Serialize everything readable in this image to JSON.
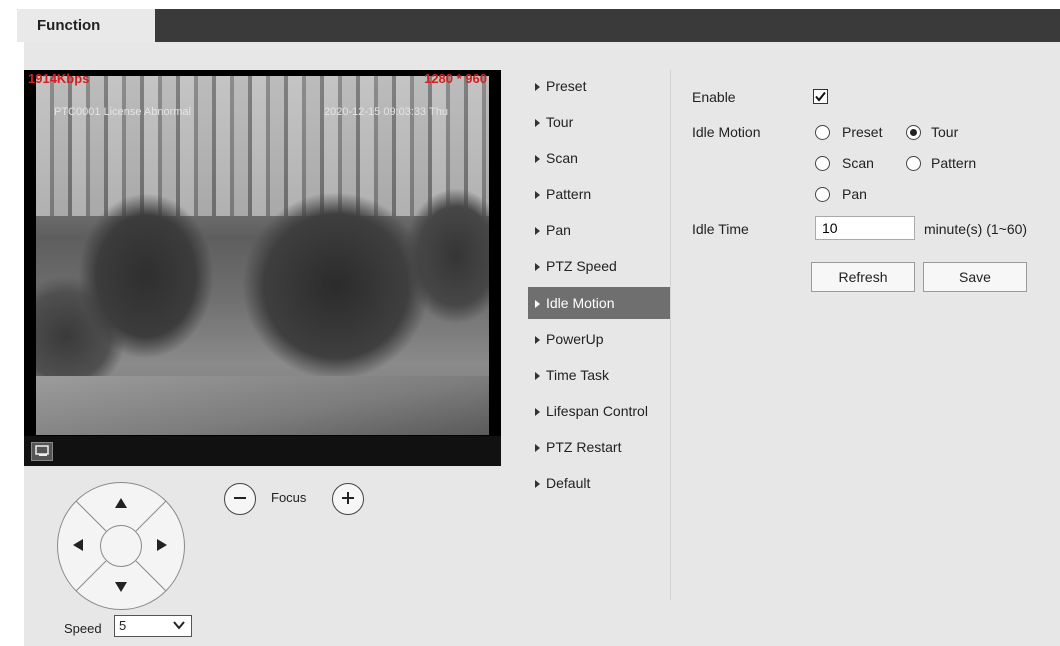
{
  "tabs": {
    "function": "Function"
  },
  "video": {
    "bitrate": "1914Kbps",
    "resolution": "1280 * 960",
    "osd_left": "PTC0001 License Abnormal",
    "osd_right": "2020-12-15 09:03:33 Thu"
  },
  "ptz": {
    "focus_label": "Focus",
    "speed_label": "Speed",
    "speed_value": "5"
  },
  "menu": {
    "items": [
      {
        "label": "Preset"
      },
      {
        "label": "Tour"
      },
      {
        "label": "Scan"
      },
      {
        "label": "Pattern"
      },
      {
        "label": "Pan"
      },
      {
        "label": "PTZ Speed"
      },
      {
        "label": "Idle Motion"
      },
      {
        "label": "PowerUp"
      },
      {
        "label": "Time Task"
      },
      {
        "label": "Lifespan Control"
      },
      {
        "label": "PTZ Restart"
      },
      {
        "label": "Default"
      }
    ],
    "active": "Idle Motion"
  },
  "form": {
    "enable_label": "Enable",
    "enable_checked": true,
    "idle_motion_label": "Idle Motion",
    "idle_motion_options": [
      "Preset",
      "Tour",
      "Scan",
      "Pattern",
      "Pan"
    ],
    "idle_motion_selected": "Tour",
    "idle_time_label": "Idle Time",
    "idle_time_value": "10",
    "idle_time_unit": "minute(s) (1~60)",
    "refresh_label": "Refresh",
    "save_label": "Save"
  }
}
